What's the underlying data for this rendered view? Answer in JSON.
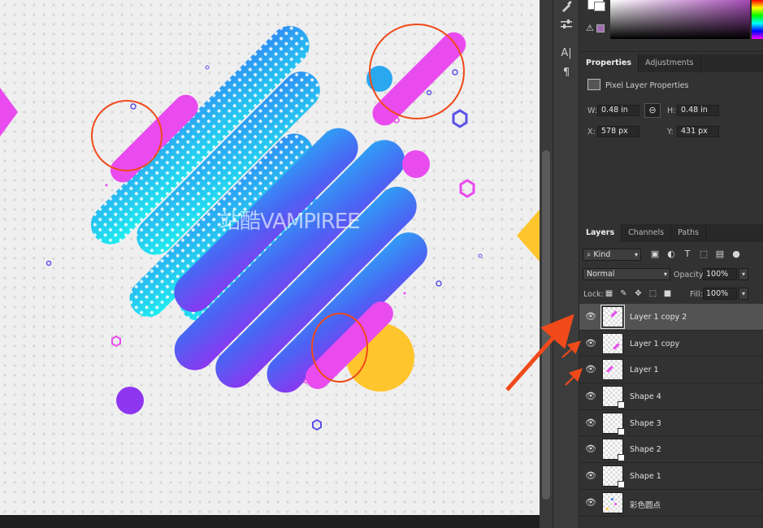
{
  "canvas": {
    "watermark": "站酷VAMPIREE",
    "colors": {
      "magenta": "#e94bef",
      "blue": "#2f8cf5",
      "cyan": "#26d5ee",
      "purple": "#8e44f0",
      "yellow": "#ffc52c",
      "annotation": "#f04a1a"
    }
  },
  "tools": {
    "icons": [
      "brush-icon",
      "adjust-sliders-icon",
      "type-panel-icon",
      "paragraph-icon"
    ],
    "type_glyph": "A|",
    "para_glyph": "¶"
  },
  "color_panel": {
    "fg_color": "#ffffff",
    "gamut_color": "#9d6bb0",
    "warning_glyph": "⚠"
  },
  "properties": {
    "tabs": [
      {
        "label": "Properties",
        "active": true
      },
      {
        "label": "Adjustments",
        "active": false
      }
    ],
    "section_label": "Pixel Layer Properties",
    "w_label": "W:",
    "w_value": "0.48 in",
    "h_label": "H:",
    "h_value": "0.48 in",
    "x_label": "X:",
    "x_value": "578 px",
    "y_label": "Y:",
    "y_value": "431 px",
    "link_glyph": "⊖"
  },
  "layers": {
    "tabs": [
      {
        "label": "Layers",
        "active": true
      },
      {
        "label": "Channels",
        "active": false
      },
      {
        "label": "Paths",
        "active": false
      }
    ],
    "filter_kind": "Kind",
    "blend_mode": "Normal",
    "opacity_label": "Opacity:",
    "opacity_value": "100%",
    "lock_label": "Lock:",
    "fill_label": "Fill:",
    "fill_value": "100%",
    "items": [
      {
        "name": "Layer 1 copy 2",
        "selected": true,
        "kind": "pixel"
      },
      {
        "name": "Layer 1 copy",
        "selected": false,
        "kind": "pixel"
      },
      {
        "name": "Layer 1",
        "selected": false,
        "kind": "pixel"
      },
      {
        "name": "Shape 4",
        "selected": false,
        "kind": "shape"
      },
      {
        "name": "Shape 3",
        "selected": false,
        "kind": "shape"
      },
      {
        "name": "Shape 2",
        "selected": false,
        "kind": "shape"
      },
      {
        "name": "Shape 1",
        "selected": false,
        "kind": "shape"
      },
      {
        "name": "彩色圆点",
        "selected": false,
        "kind": "dots"
      }
    ]
  }
}
